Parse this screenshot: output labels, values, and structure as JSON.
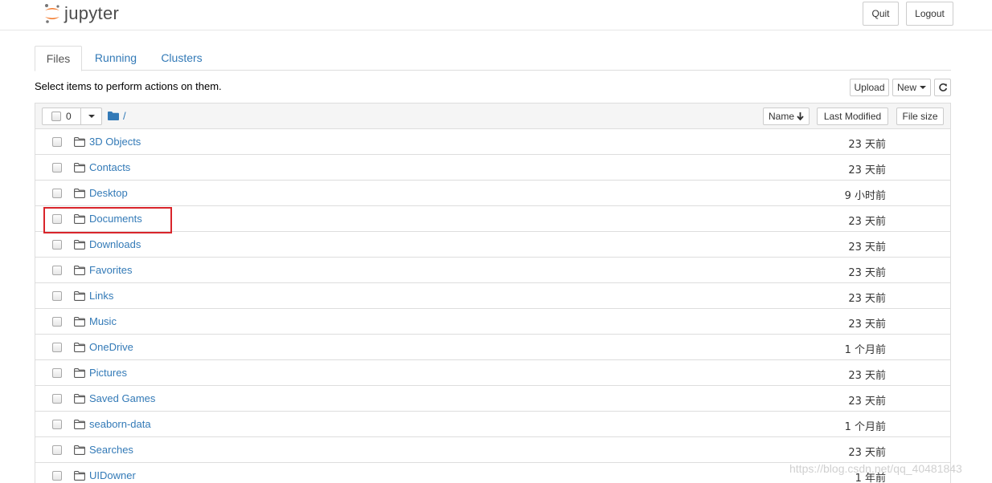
{
  "header": {
    "logo_text": "jupyter",
    "quit_label": "Quit",
    "logout_label": "Logout"
  },
  "tabs": [
    {
      "label": "Files",
      "active": true
    },
    {
      "label": "Running",
      "active": false
    },
    {
      "label": "Clusters",
      "active": false
    }
  ],
  "toolbar": {
    "instructions": "Select items to perform actions on them.",
    "upload_label": "Upload",
    "new_label": "New",
    "refresh_icon": "refresh-icon"
  },
  "list_header": {
    "selected_count": "0",
    "breadcrumb": "/",
    "sort_name_label": "Name",
    "sort_modified_label": "Last Modified",
    "sort_size_label": "File size"
  },
  "items": [
    {
      "name": "3D Objects",
      "modified": "23 天前"
    },
    {
      "name": "Contacts",
      "modified": "23 天前"
    },
    {
      "name": "Desktop",
      "modified": "9 小时前"
    },
    {
      "name": "Documents",
      "modified": "23 天前"
    },
    {
      "name": "Downloads",
      "modified": "23 天前"
    },
    {
      "name": "Favorites",
      "modified": "23 天前"
    },
    {
      "name": "Links",
      "modified": "23 天前"
    },
    {
      "name": "Music",
      "modified": "23 天前"
    },
    {
      "name": "OneDrive",
      "modified": "1 个月前"
    },
    {
      "name": "Pictures",
      "modified": "23 天前"
    },
    {
      "name": "Saved Games",
      "modified": "23 天前"
    },
    {
      "name": "seaborn-data",
      "modified": "1 个月前"
    },
    {
      "name": "Searches",
      "modified": "23 天前"
    },
    {
      "name": "UIDowner",
      "modified": "1 年前"
    }
  ],
  "watermark": "https://blog.csdn.net/qq_40481843",
  "colors": {
    "link": "#337ab7",
    "highlight": "#d9252b",
    "logo_orange": "#f37626"
  }
}
